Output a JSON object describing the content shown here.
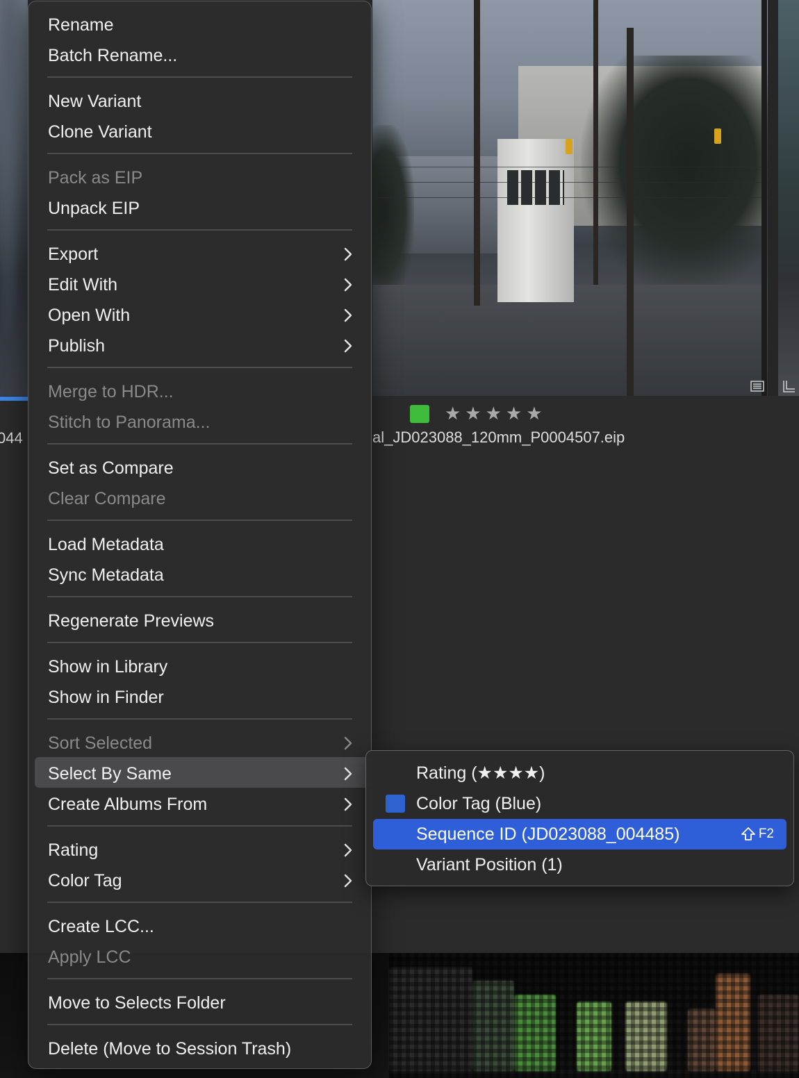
{
  "background": {
    "left_filename_fragment": "044",
    "right_filename": "al_JD023088_120mm_P0004507.eip",
    "rating_stars": "★★★★★",
    "color_tag": "#3fbb3c"
  },
  "menu": {
    "groups": [
      {
        "items": [
          {
            "label": "Rename",
            "enabled": true
          },
          {
            "label": "Batch Rename...",
            "enabled": true
          }
        ]
      },
      {
        "items": [
          {
            "label": "New Variant",
            "enabled": true
          },
          {
            "label": "Clone Variant",
            "enabled": true
          }
        ]
      },
      {
        "items": [
          {
            "label": "Pack as EIP",
            "enabled": false
          },
          {
            "label": "Unpack EIP",
            "enabled": true
          }
        ]
      },
      {
        "items": [
          {
            "label": "Export",
            "enabled": true,
            "submenu": true
          },
          {
            "label": "Edit With",
            "enabled": true,
            "submenu": true
          },
          {
            "label": "Open With",
            "enabled": true,
            "submenu": true
          },
          {
            "label": "Publish",
            "enabled": true,
            "submenu": true
          }
        ]
      },
      {
        "items": [
          {
            "label": "Merge to HDR...",
            "enabled": false
          },
          {
            "label": "Stitch to Panorama...",
            "enabled": false
          }
        ]
      },
      {
        "items": [
          {
            "label": "Set as Compare",
            "enabled": true
          },
          {
            "label": "Clear Compare",
            "enabled": false
          }
        ]
      },
      {
        "items": [
          {
            "label": "Load Metadata",
            "enabled": true
          },
          {
            "label": "Sync Metadata",
            "enabled": true
          }
        ]
      },
      {
        "items": [
          {
            "label": "Regenerate Previews",
            "enabled": true
          }
        ]
      },
      {
        "items": [
          {
            "label": "Show in Library",
            "enabled": true
          },
          {
            "label": "Show in Finder",
            "enabled": true
          }
        ]
      },
      {
        "items": [
          {
            "label": "Sort Selected",
            "enabled": false,
            "submenu": true
          },
          {
            "label": "Select By Same",
            "enabled": true,
            "submenu": true,
            "highlighted": true
          },
          {
            "label": "Create Albums From",
            "enabled": true,
            "submenu": true
          }
        ]
      },
      {
        "items": [
          {
            "label": "Rating",
            "enabled": true,
            "submenu": true
          },
          {
            "label": "Color Tag",
            "enabled": true,
            "submenu": true
          }
        ]
      },
      {
        "items": [
          {
            "label": "Create LCC...",
            "enabled": true
          },
          {
            "label": "Apply LCC",
            "enabled": false
          }
        ]
      },
      {
        "items": [
          {
            "label": "Move to Selects Folder",
            "enabled": true
          }
        ]
      },
      {
        "items": [
          {
            "label": "Delete (Move to Session Trash)",
            "enabled": true
          }
        ]
      }
    ]
  },
  "submenu": {
    "items": [
      {
        "label": "Rating (★★★★)"
      },
      {
        "label": "Color Tag (Blue)",
        "swatch": "#2e63cf"
      },
      {
        "label": "Sequence ID (JD023088_004485)",
        "active": true,
        "shortcut_key": "F2",
        "shortcut_modifier": "shift-icon"
      },
      {
        "label": "Variant Position (1)"
      }
    ]
  }
}
